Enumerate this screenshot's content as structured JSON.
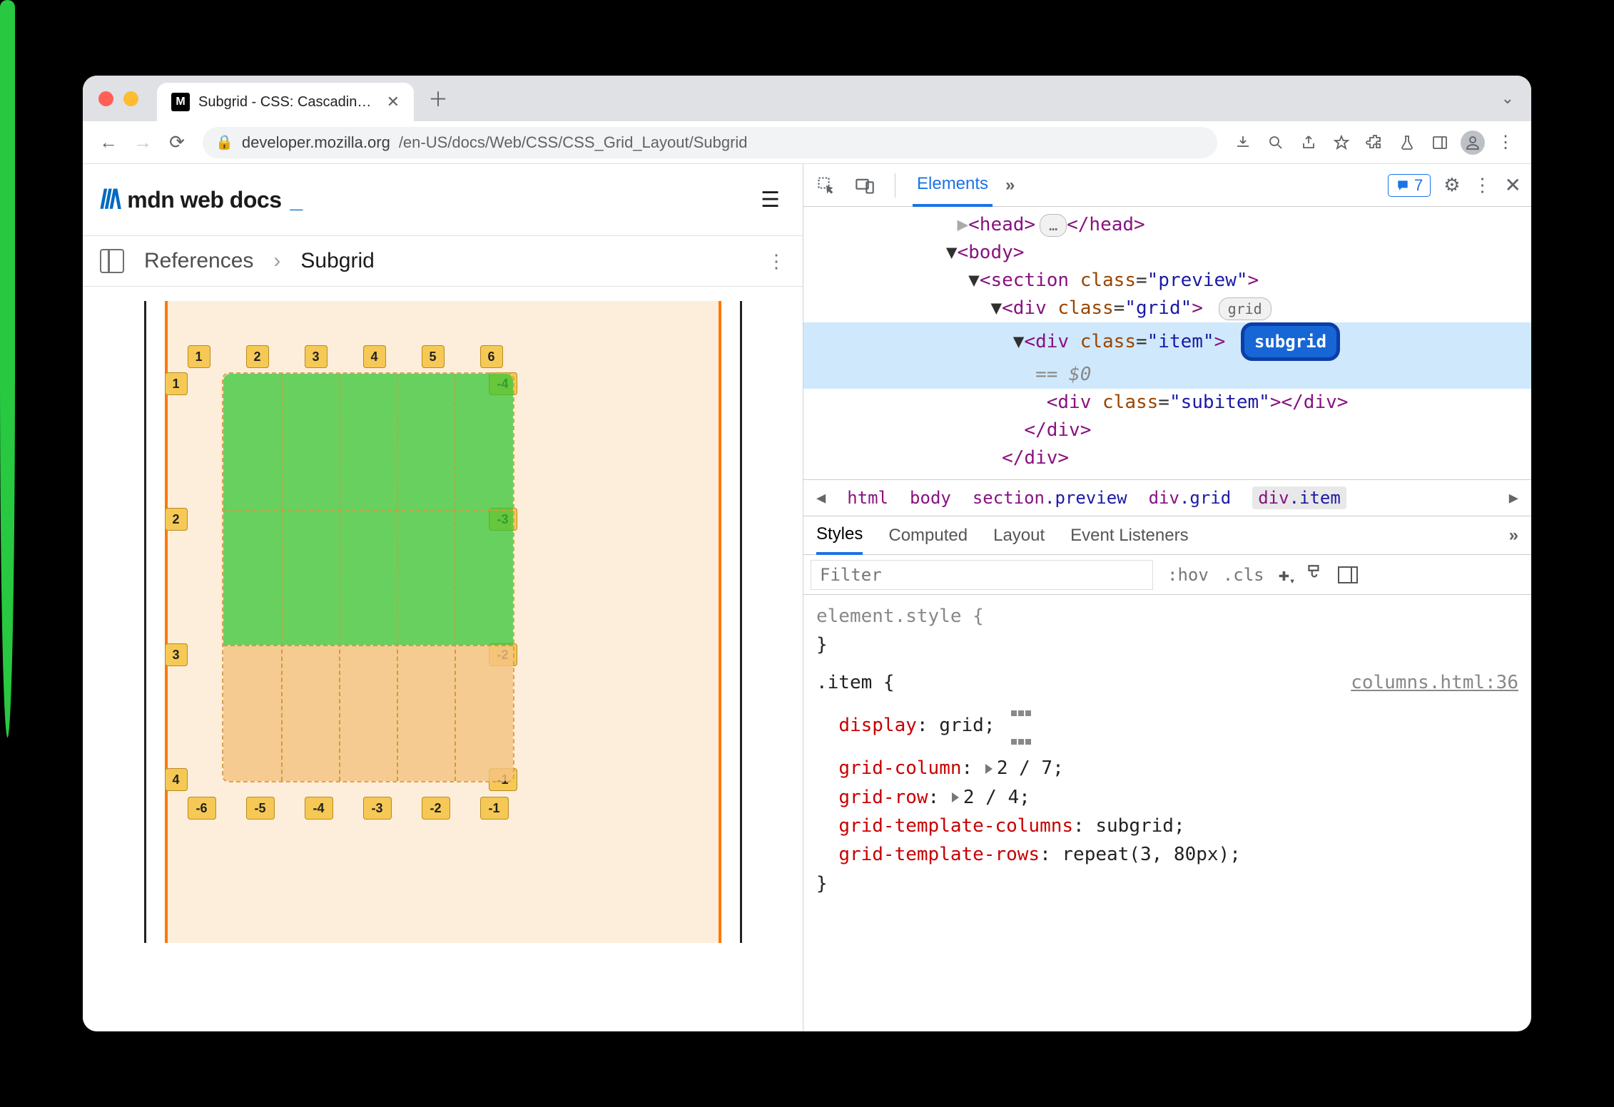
{
  "tab": {
    "title": "Subgrid - CSS: Cascading Styl…"
  },
  "url": {
    "host": "developer.mozilla.org",
    "path": "/en-US/docs/Web/CSS/CSS_Grid_Layout/Subgrid"
  },
  "mdn": {
    "brand": "mdn web docs",
    "bc1": "References",
    "bc2": "Subgrid"
  },
  "grid_overlay": {
    "top": [
      "1",
      "2",
      "3",
      "4",
      "5",
      "6"
    ],
    "left": [
      "1",
      "2",
      "3",
      "4"
    ],
    "right": [
      "-4",
      "-3",
      "-2",
      "-1"
    ],
    "bottom": [
      "-6",
      "-5",
      "-4",
      "-3",
      "-2",
      "-1"
    ]
  },
  "devtools": {
    "tabs": {
      "elements": "Elements",
      "issues_count": "7"
    },
    "dom": {
      "l0": "<head>…</head>",
      "l1": "<body>",
      "l2": "<section class=\"preview\">",
      "l3": "<div class=\"grid\">",
      "pill_grid": "grid",
      "l4": "<div class=\"item\">",
      "pill_subgrid": "subgrid",
      "console_ref": "== $0",
      "l5": "<div class=\"subitem\"></div>",
      "l6": "</div>",
      "l7": "</div>"
    },
    "crumbs": [
      "html",
      "body",
      "section.preview",
      "div.grid",
      "div.item"
    ],
    "style_tabs": [
      "Styles",
      "Computed",
      "Layout",
      "Event Listeners"
    ],
    "filter": {
      "placeholder": "Filter",
      "hov": ":hov",
      "cls": ".cls"
    },
    "rules": {
      "elstyle_open": "element.style {",
      "close": "}",
      "sel": ".item {",
      "src": "columns.html:36",
      "p1n": "display",
      "p1v": "grid",
      "p2n": "grid-column",
      "p2v": "2 / 7",
      "p3n": "grid-row",
      "p3v": "2 / 4",
      "p4n": "grid-template-columns",
      "p4v": "subgrid",
      "p5n": "grid-template-rows",
      "p5v": "repeat(3, 80px)"
    }
  }
}
